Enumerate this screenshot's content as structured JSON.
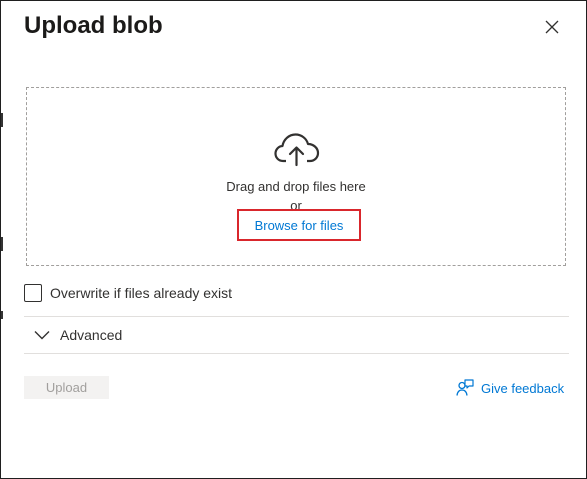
{
  "panel": {
    "title": "Upload blob",
    "close_icon": "close-icon"
  },
  "dropzone": {
    "icon": "cloud-upload-icon",
    "drag_text": "Drag and drop files here",
    "or_text": "or",
    "browse_label": "Browse for files"
  },
  "overwrite": {
    "label": "Overwrite if files already exist",
    "checked": false
  },
  "advanced": {
    "label": "Advanced",
    "icon": "chevron-down-icon",
    "expanded": false
  },
  "actions": {
    "upload_label": "Upload",
    "upload_enabled": false,
    "feedback_label": "Give feedback",
    "feedback_icon": "feedback-person-icon"
  },
  "colors": {
    "accent": "#0078d4",
    "highlight_border": "#d9262c",
    "disabled_bg": "#f3f2f1",
    "disabled_text": "#a19f9d"
  }
}
